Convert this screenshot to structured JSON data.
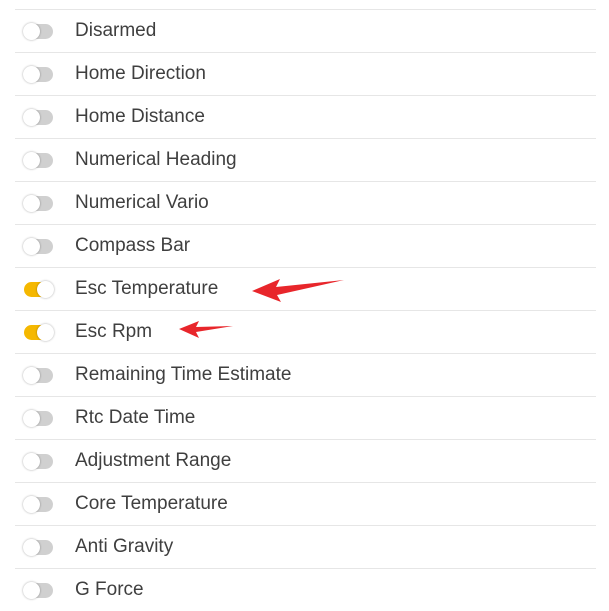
{
  "colors": {
    "toggle_on": "#f5b800",
    "toggle_off": "#d0d0d0",
    "label_text": "#3f3f3f",
    "divider": "#e6e6e6",
    "annotation_arrow": "#e8262b"
  },
  "items": [
    {
      "label": "Disarmed",
      "enabled": false
    },
    {
      "label": "Home Direction",
      "enabled": false
    },
    {
      "label": "Home Distance",
      "enabled": false
    },
    {
      "label": "Numerical Heading",
      "enabled": false
    },
    {
      "label": "Numerical Vario",
      "enabled": false
    },
    {
      "label": "Compass Bar",
      "enabled": false
    },
    {
      "label": "Esc Temperature",
      "enabled": true
    },
    {
      "label": "Esc Rpm",
      "enabled": true
    },
    {
      "label": "Remaining Time Estimate",
      "enabled": false
    },
    {
      "label": "Rtc Date Time",
      "enabled": false
    },
    {
      "label": "Adjustment Range",
      "enabled": false
    },
    {
      "label": "Core Temperature",
      "enabled": false
    },
    {
      "label": "Anti Gravity",
      "enabled": false
    },
    {
      "label": "G Force",
      "enabled": false
    }
  ]
}
